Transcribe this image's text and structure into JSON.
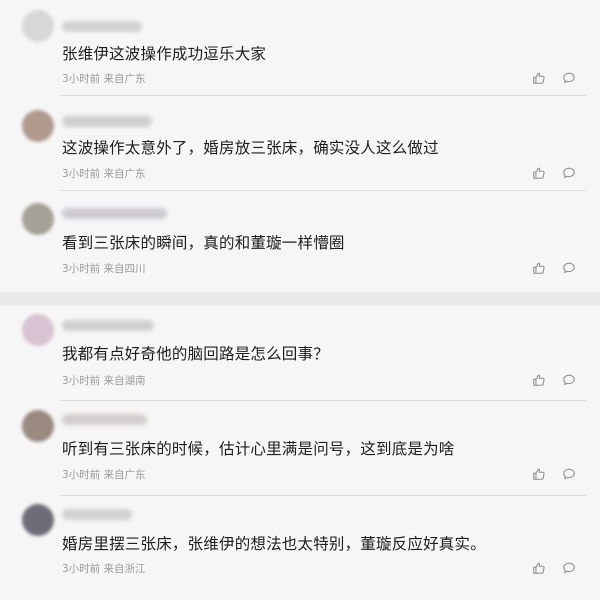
{
  "comments": [
    {
      "text": "张维伊这波操作成功逗乐大家",
      "time": "3小时前",
      "location": "来自广东",
      "avatar_color": "#d7d7d7",
      "name_color": "#c9c9c9"
    },
    {
      "text": "这波操作太意外了，婚房放三张床，确实没人这么做过",
      "time": "3小时前",
      "location": "来自广东",
      "avatar_color": "#b09a8e",
      "name_color": "#c4c4c4"
    },
    {
      "text": "看到三张床的瞬间，真的和董璇一样懵圈",
      "time": "3小时前",
      "location": "来自四川",
      "avatar_color": "#a6a196",
      "name_color": "#c2bfca"
    },
    {
      "text": "我都有点好奇他的脑回路是怎么回事？",
      "time": "3小时前",
      "location": "来自湖南",
      "avatar_color": "#d8c3d2",
      "name_color": "#c6c6c6"
    },
    {
      "text": "听到有三张床的时候，估计心里满是问号，这到底是为啥",
      "time": "3小时前",
      "location": "来自广东",
      "avatar_color": "#9a8a80",
      "name_color": "#c9c4c2"
    },
    {
      "text": "婚房里摆三张床，张维伊的想法也太特别，董璇反应好真实。",
      "time": "3小时前",
      "location": "来自浙江",
      "avatar_color": "#6f6c7a",
      "name_color": "#c8c8c8"
    }
  ],
  "icons": {
    "like": "thumbs-up-icon",
    "reply": "comment-bubble-icon"
  }
}
